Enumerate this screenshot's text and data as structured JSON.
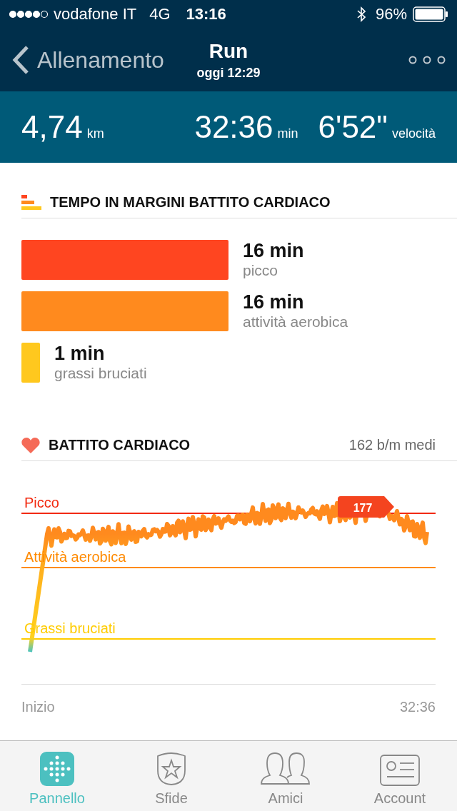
{
  "status_bar": {
    "carrier": "vodafone IT",
    "network": "4G",
    "time": "13:16",
    "battery": "96%"
  },
  "header": {
    "back": "Allenamento",
    "title": "Run",
    "subtitle": "oggi 12:29"
  },
  "stats": [
    {
      "value": "4,74",
      "unit": "km"
    },
    {
      "value": "32:36",
      "unit": "min"
    },
    {
      "value": "6'52\"",
      "unit": "velocità"
    }
  ],
  "zones_section": {
    "title": "TEMPO IN MARGINI BATTITO CARDIACO",
    "zones": [
      {
        "time": "16 min",
        "label": "picco",
        "color": "#ff4520"
      },
      {
        "time": "16 min",
        "label": "attività aerobica",
        "color": "#ff8a1e"
      },
      {
        "time": "1 min",
        "label": "grassi bruciati",
        "color": "#ffc81e"
      }
    ]
  },
  "heart_section": {
    "title": "BATTITO CARDIACO",
    "average": "162 b/m medi",
    "zone_lines": [
      {
        "label": "Picco",
        "color": "#f2290f"
      },
      {
        "label": "Attività aerobica",
        "color": "#ff8a00"
      },
      {
        "label": "Grassi bruciati",
        "color": "#ffcc00"
      }
    ],
    "peak_label": "177",
    "start_label": "Inizio",
    "end_label": "32:36"
  },
  "tabs": [
    {
      "label": "Pannello",
      "selected": true
    },
    {
      "label": "Sfide",
      "selected": false
    },
    {
      "label": "Amici",
      "selected": false
    },
    {
      "label": "Account",
      "selected": false
    }
  ]
}
